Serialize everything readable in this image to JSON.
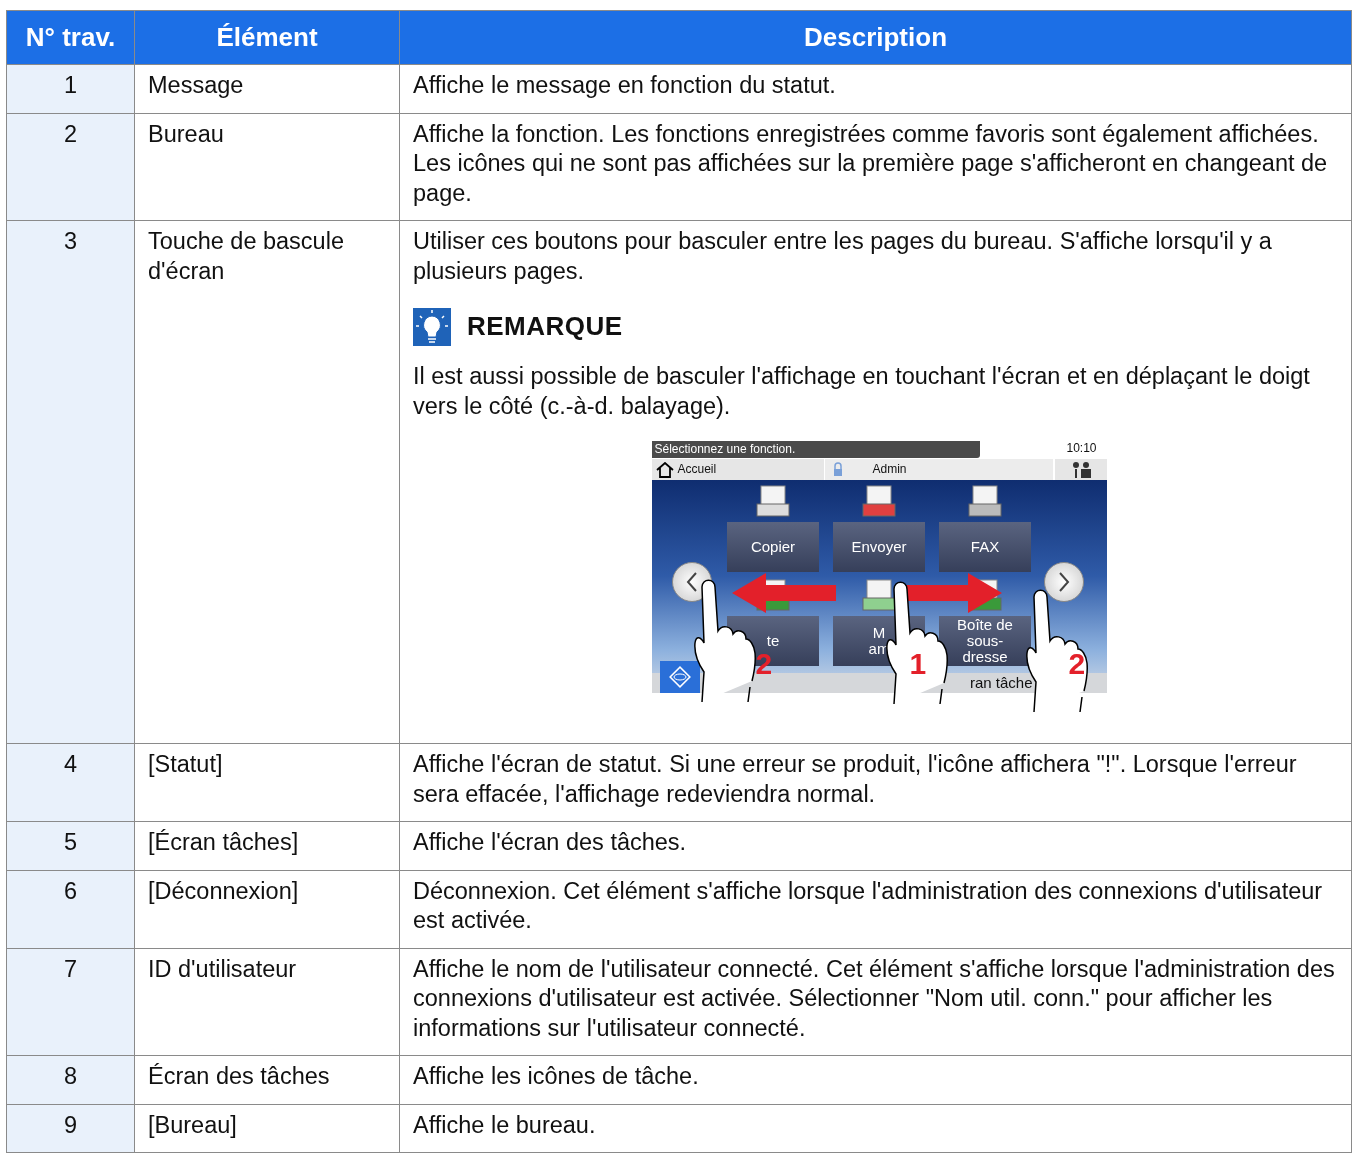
{
  "table": {
    "columns": [
      "N° trav.",
      "Élément",
      "Description"
    ],
    "rows": [
      {
        "number": "1",
        "element": "Message",
        "description": [
          "Affiche le message en fonction du statut."
        ]
      },
      {
        "number": "2",
        "element": "Bureau",
        "description": [
          "Affiche la fonction. Les fonctions enregistrées comme favoris sont également affichées. Les icônes qui ne sont pas affichées sur la première page s'afficheront en changeant de page."
        ]
      },
      {
        "number": "3",
        "element": "Touche de bascule d'écran",
        "description": [
          "Utiliser ces boutons pour basculer entre les pages du bureau. S'affiche lorsqu'il y a plusieurs pages."
        ],
        "note": {
          "title": "REMARQUE",
          "text": "Il est aussi possible de basculer l'affichage en touchant l'écran et en déplaçant le doigt vers le côté (c.-à-d. balayage).",
          "figure": {
            "message": "Sélectionnez une fonction.",
            "time": "10:10",
            "home": "Accueil",
            "user": "Admin",
            "tiles": [
              {
                "lines": [
                  "Copier"
                ]
              },
              {
                "lines": [
                  "Envoyer"
                ]
              },
              {
                "lines": [
                  "FAX"
                ]
              },
              {
                "lines": [
                  "te"
                ]
              },
              {
                "lines": [
                  "M",
                  "am"
                ]
              },
              {
                "lines": [
                  "Boîte de",
                  "sous-",
                  "dresse"
                ]
              }
            ],
            "task_bar": "ran tâche",
            "gesture_steps": [
              "2",
              "1",
              "2"
            ]
          }
        }
      },
      {
        "number": "4",
        "element": "[Statut]",
        "description": [
          "Affiche l'écran de statut. Si une erreur se produit, l'icône affichera \"!\". Lorsque l'erreur sera effacée, l'affichage redeviendra normal."
        ]
      },
      {
        "number": "5",
        "element": "[Écran tâches]",
        "description": [
          "Affiche l'écran des tâches."
        ]
      },
      {
        "number": "6",
        "element": "[Déconnexion]",
        "description": [
          "Déconnexion. Cet élément s'affiche lorsque l'administration des connexions d'utilisateur est activée."
        ]
      },
      {
        "number": "7",
        "element": "ID d'utilisateur",
        "description": [
          "Affiche le nom de l'utilisateur connecté. Cet élément s'affiche lorsque l'administration des connexions d'utilisateur est activée. Sélectionner \"Nom util. conn.\" pour afficher les informations sur l'utilisateur connecté."
        ]
      },
      {
        "number": "8",
        "element": "Écran des tâches",
        "description": [
          "Affiche les icônes de tâche."
        ]
      },
      {
        "number": "9",
        "element": "[Bureau]",
        "description": [
          "Affiche le bureau."
        ]
      }
    ]
  }
}
